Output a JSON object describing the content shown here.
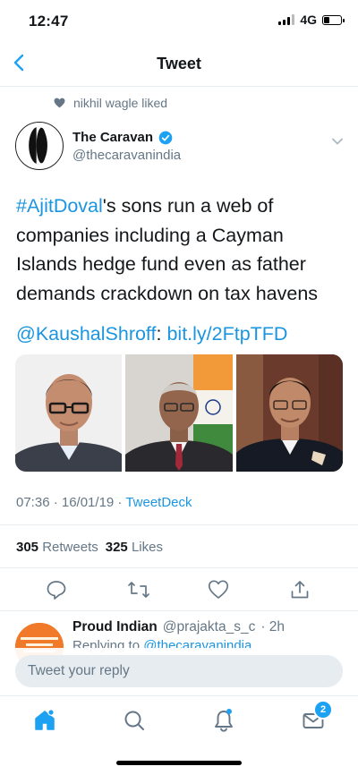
{
  "status_bar": {
    "time": "12:47",
    "network": "4G",
    "signal_bars": 3,
    "battery_fraction": 0.3
  },
  "nav": {
    "title": "Tweet",
    "back_icon": "chevron-left-icon"
  },
  "social_context": {
    "icon": "heart-icon",
    "text": "nikhil wagle liked"
  },
  "tweet": {
    "author": {
      "name": "The Caravan",
      "handle": "@thecaravanindia",
      "verified": true
    },
    "hashtag": "#AjitDoval",
    "body": "'s sons run a web of companies including a Cayman Islands hedge fund even as father demands crackdown on tax havens",
    "mention": "@KaushalShroff",
    "colon": ":",
    "url": "bit.ly/2FtpTFD",
    "timestamp": "07:36 · 16/01/19 · ",
    "source": "TweetDeck",
    "retweets": "305",
    "retweets_label": "Retweets",
    "likes": "325",
    "likes_label": "Likes"
  },
  "reply_preview": {
    "name": "Proud Indian",
    "handle": "@prajakta_s_c",
    "time": "· 2h",
    "replying_prefix": "Replying to ",
    "replying_to": "@thecaravanindia"
  },
  "composer": {
    "placeholder": "Tweet your reply"
  },
  "tabbar": {
    "items": [
      "home-icon",
      "search-icon",
      "notifications-icon",
      "messages-icon"
    ],
    "messages_badge": "2"
  },
  "colors": {
    "accent": "#1da1f2",
    "link": "#1b95e0",
    "muted": "#657786",
    "text": "#14171a",
    "divider": "#e6ecf0"
  }
}
